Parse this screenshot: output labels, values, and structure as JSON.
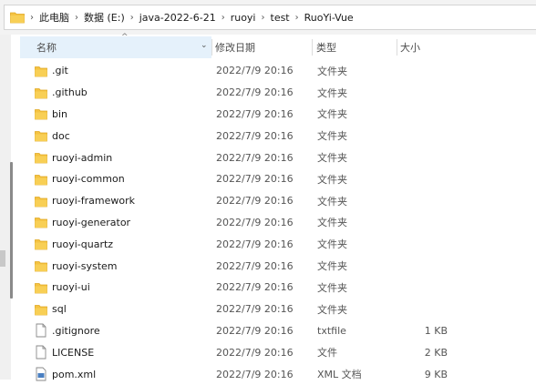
{
  "breadcrumb": [
    "此电脑",
    "数据 (E:)",
    "java-2022-6-21",
    "ruoyi",
    "test",
    "RuoYi-Vue"
  ],
  "columns": {
    "name": "名称",
    "date": "修改日期",
    "type": "类型",
    "size": "大小"
  },
  "files": [
    {
      "name": ".git",
      "date": "2022/7/9 20:16",
      "type": "文件夹",
      "size": "",
      "kind": "folder"
    },
    {
      "name": ".github",
      "date": "2022/7/9 20:16",
      "type": "文件夹",
      "size": "",
      "kind": "folder"
    },
    {
      "name": "bin",
      "date": "2022/7/9 20:16",
      "type": "文件夹",
      "size": "",
      "kind": "folder"
    },
    {
      "name": "doc",
      "date": "2022/7/9 20:16",
      "type": "文件夹",
      "size": "",
      "kind": "folder"
    },
    {
      "name": "ruoyi-admin",
      "date": "2022/7/9 20:16",
      "type": "文件夹",
      "size": "",
      "kind": "folder"
    },
    {
      "name": "ruoyi-common",
      "date": "2022/7/9 20:16",
      "type": "文件夹",
      "size": "",
      "kind": "folder"
    },
    {
      "name": "ruoyi-framework",
      "date": "2022/7/9 20:16",
      "type": "文件夹",
      "size": "",
      "kind": "folder"
    },
    {
      "name": "ruoyi-generator",
      "date": "2022/7/9 20:16",
      "type": "文件夹",
      "size": "",
      "kind": "folder"
    },
    {
      "name": "ruoyi-quartz",
      "date": "2022/7/9 20:16",
      "type": "文件夹",
      "size": "",
      "kind": "folder"
    },
    {
      "name": "ruoyi-system",
      "date": "2022/7/9 20:16",
      "type": "文件夹",
      "size": "",
      "kind": "folder"
    },
    {
      "name": "ruoyi-ui",
      "date": "2022/7/9 20:16",
      "type": "文件夹",
      "size": "",
      "kind": "folder"
    },
    {
      "name": "sql",
      "date": "2022/7/9 20:16",
      "type": "文件夹",
      "size": "",
      "kind": "folder"
    },
    {
      "name": ".gitignore",
      "date": "2022/7/9 20:16",
      "type": "txtfile",
      "size": "1 KB",
      "kind": "file"
    },
    {
      "name": "LICENSE",
      "date": "2022/7/9 20:16",
      "type": "文件",
      "size": "2 KB",
      "kind": "file"
    },
    {
      "name": "pom.xml",
      "date": "2022/7/9 20:16",
      "type": "XML 文档",
      "size": "9 KB",
      "kind": "xml"
    }
  ],
  "icons": {
    "breadcrumb_root": "folder-icon",
    "folder": "folder-icon",
    "file": "file-icon",
    "xml": "xml-file-icon",
    "sort": "sort-up-icon",
    "column_dropdown": "chevron-down-icon"
  },
  "colors": {
    "folder": "#f5c342",
    "folder_dark": "#e0a820",
    "header_selected": "#e5f1fb",
    "accent_border": "#d4d4d4"
  }
}
